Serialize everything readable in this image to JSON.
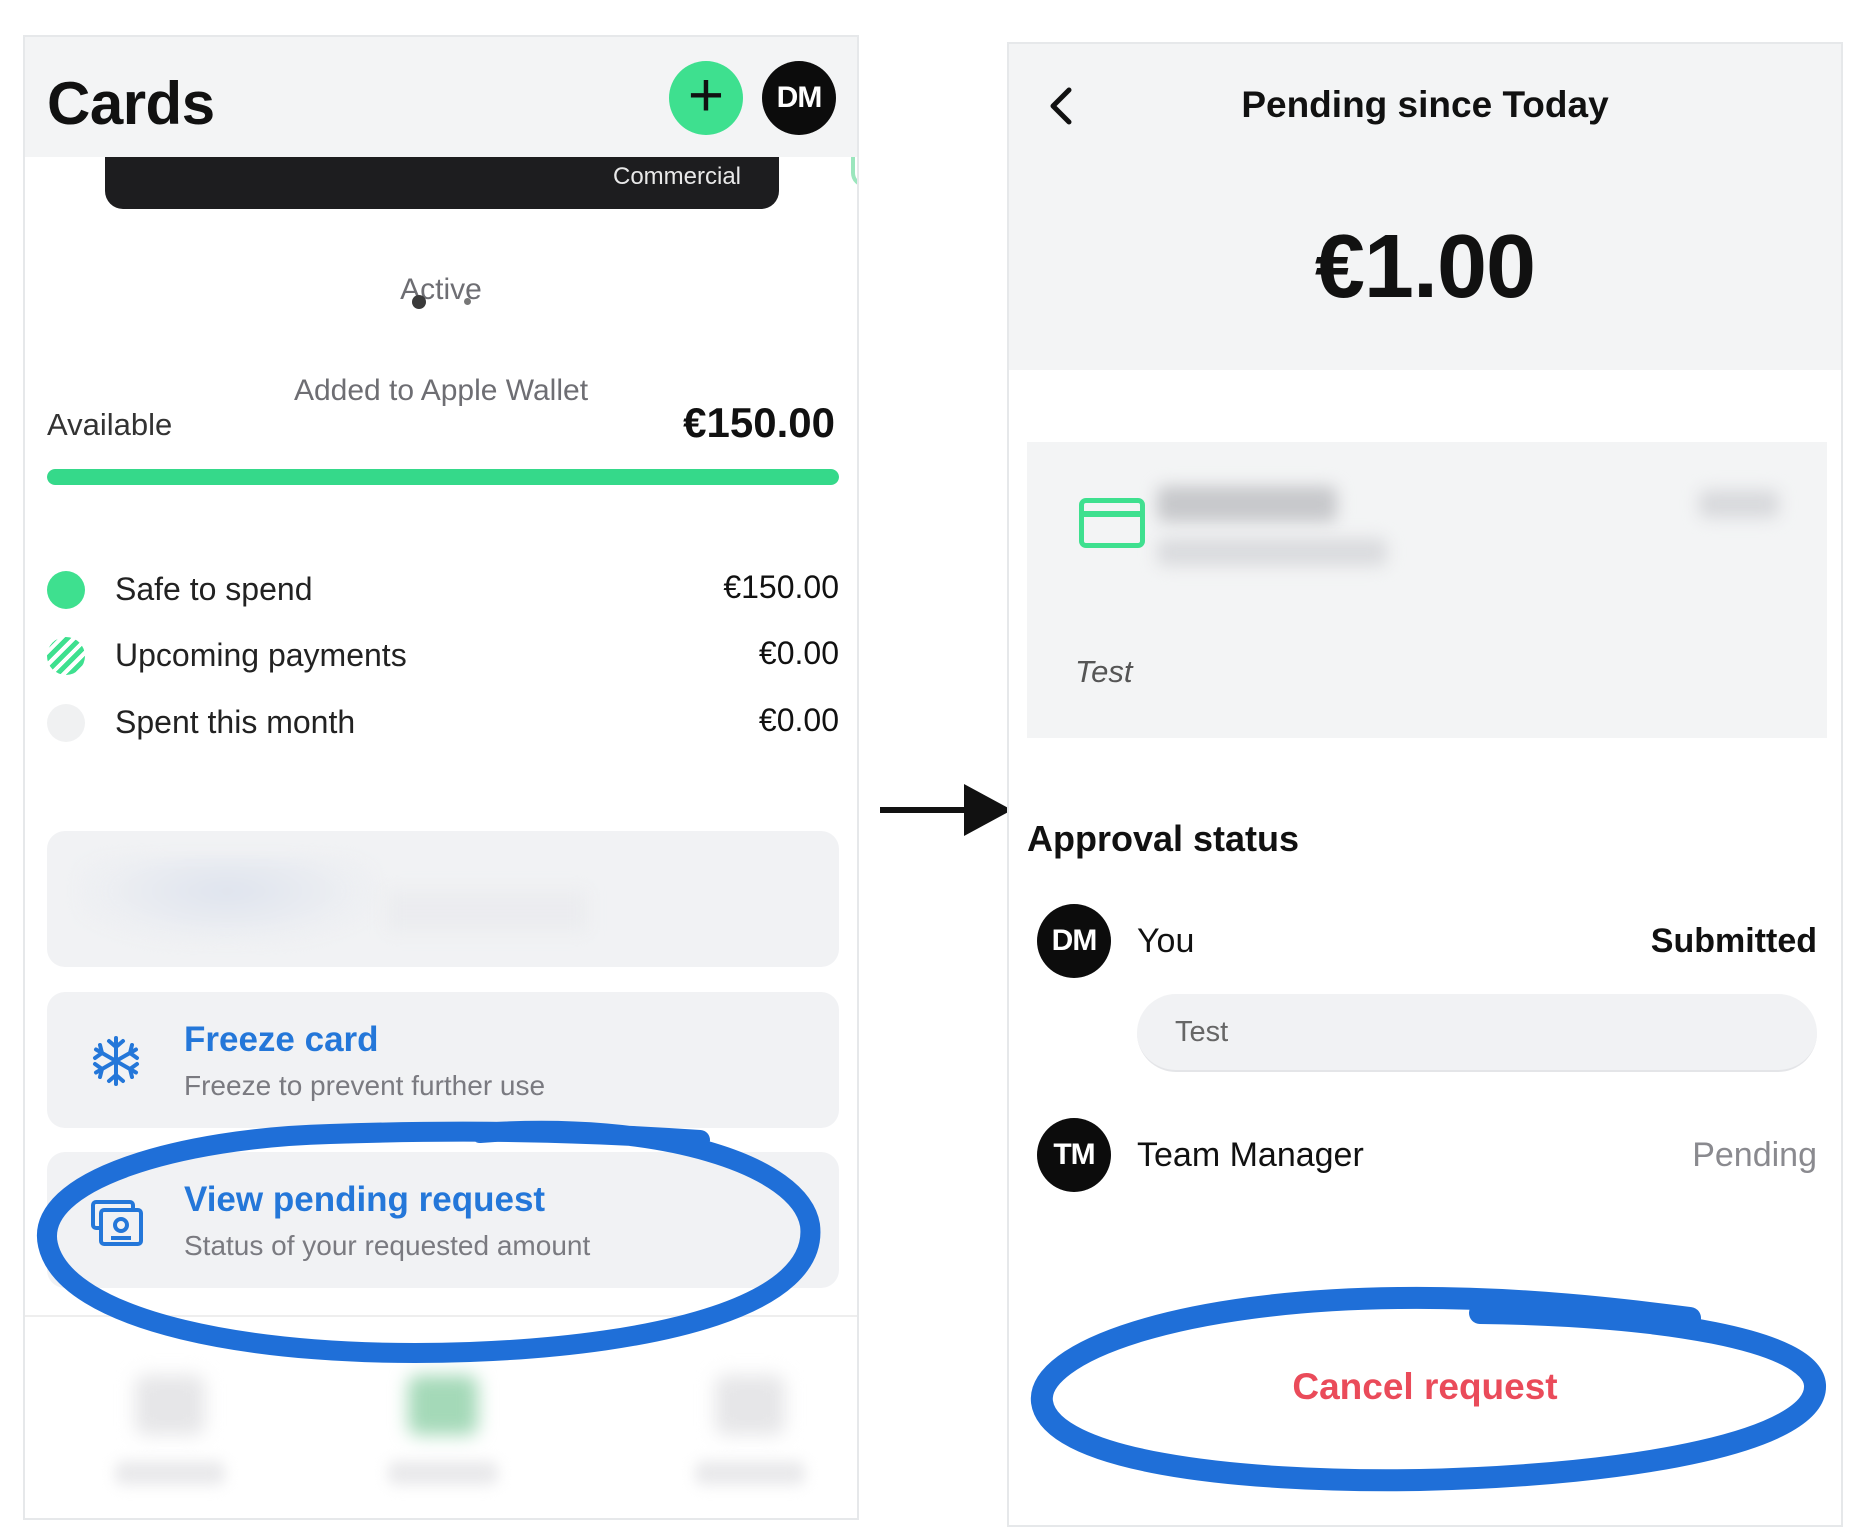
{
  "colors": {
    "accent_green": "#3ee08f",
    "link_blue": "#2477d9",
    "danger_red": "#ea4b5a",
    "annotation_blue": "#1f6fd8"
  },
  "left_screen": {
    "title": "Cards",
    "avatar_initials": "DM",
    "card_label": "Commercial",
    "card_status": "Active",
    "wallet_status": "Added to Apple Wallet",
    "pager": {
      "current": 1,
      "total": 2
    },
    "available": {
      "label": "Available",
      "value": "€150.00",
      "fraction_available": 1.0
    },
    "breakdown": [
      {
        "icon": "solid-green-dot-icon",
        "label": "Safe to spend",
        "value": "€150.00"
      },
      {
        "icon": "striped-green-dot-icon",
        "label": "Upcoming payments",
        "value": "€0.00"
      },
      {
        "icon": "grey-dot-icon",
        "label": "Spent this month",
        "value": "€0.00"
      }
    ],
    "actions": [
      {
        "icon": "snowflake-icon",
        "title": "Freeze card",
        "subtitle": "Freeze to prevent further use"
      },
      {
        "icon": "pending-request-icon",
        "title": "View pending request",
        "subtitle": "Status of your requested amount"
      }
    ]
  },
  "right_screen": {
    "title": "Pending since Today",
    "amount": "€1.00",
    "note": "Test",
    "approval_title": "Approval status",
    "approvers": [
      {
        "initials": "DM",
        "name": "You",
        "status": "Submitted",
        "comment": "Test"
      },
      {
        "initials": "TM",
        "name": "Team Manager",
        "status": "Pending"
      }
    ],
    "cancel_label": "Cancel request"
  }
}
